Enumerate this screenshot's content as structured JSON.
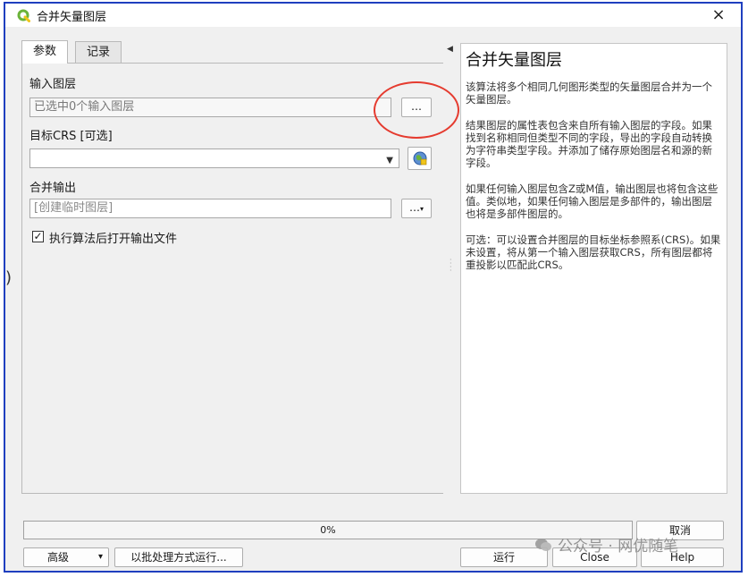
{
  "window": {
    "title": "合并矢量图层",
    "close_symbol": "×"
  },
  "tabs": [
    {
      "label": "参数",
      "active": true
    },
    {
      "label": "记录",
      "active": false
    }
  ],
  "params": {
    "input_layer_label": "输入图层",
    "input_layer_value": "已选中0个输入图层",
    "input_layer_button": "…",
    "target_crs_label": "目标CRS [可选]",
    "target_crs_value": "",
    "merged_output_label": "合并输出",
    "merged_output_placeholder": "[创建临时图层]",
    "merged_output_button": "…",
    "open_output_checkbox_label": "执行算法后打开输出文件",
    "open_output_checked": true
  },
  "help": {
    "title": "合并矢量图层",
    "paragraphs": [
      "该算法将多个相同几何图形类型的矢量图层合并为一个矢量图层。",
      "结果图层的属性表包含来自所有输入图层的字段。如果找到名称相同但类型不同的字段，导出的字段自动转换为字符串类型字段。并添加了储存原始图层名和源的新字段。",
      "如果任何输入图层包含Z或M值，输出图层也将包含这些值。类似地，如果任何输入图层是多部件的，输出图层也将是多部件图层的。",
      "可选：可以设置合并图层的目标坐标参照系(CRS)。如果未设置，将从第一个输入图层获取CRS，所有图层都将重投影以匹配此CRS。"
    ]
  },
  "progress": {
    "percent": 0,
    "text": "0%"
  },
  "buttons": {
    "cancel": "取消",
    "advanced": "高级",
    "batch": "以批处理方式运行...",
    "run": "运行",
    "close": "Close",
    "help": "Help"
  },
  "watermark": "公众号 · 网优随笔",
  "colors": {
    "frame_border": "#1f3fbf",
    "annotation_circle": "#e53b2f",
    "qgis_green": "#6bb33a"
  }
}
